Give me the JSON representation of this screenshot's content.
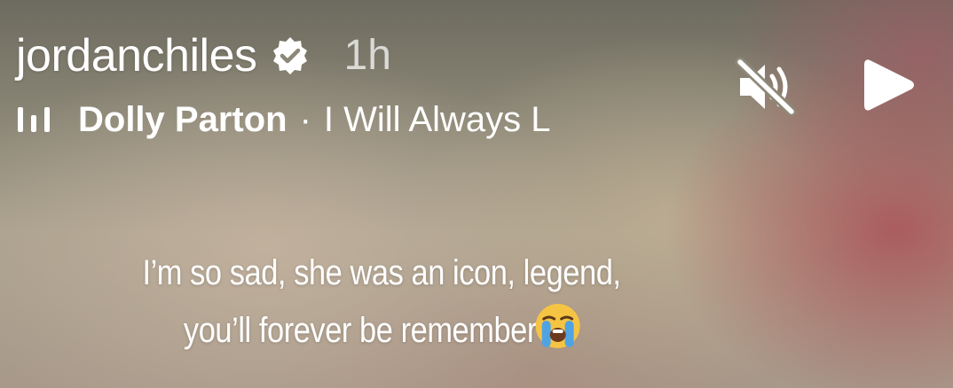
{
  "story": {
    "username": "jordanchiles",
    "verified_icon": "verified-badge-icon",
    "timestamp": "1h"
  },
  "music": {
    "icon": "music-bars-icon",
    "artist": "Dolly Parton",
    "separator": "·",
    "song": "I Will Always L"
  },
  "controls": {
    "mute_icon": "speaker-muted-icon",
    "play_icon": "play-icon"
  },
  "caption": {
    "line1": "I’m so sad, she was an icon, legend,",
    "line2": "you’ll forever be remember",
    "emoji": "loudly-crying-face-emoji"
  }
}
